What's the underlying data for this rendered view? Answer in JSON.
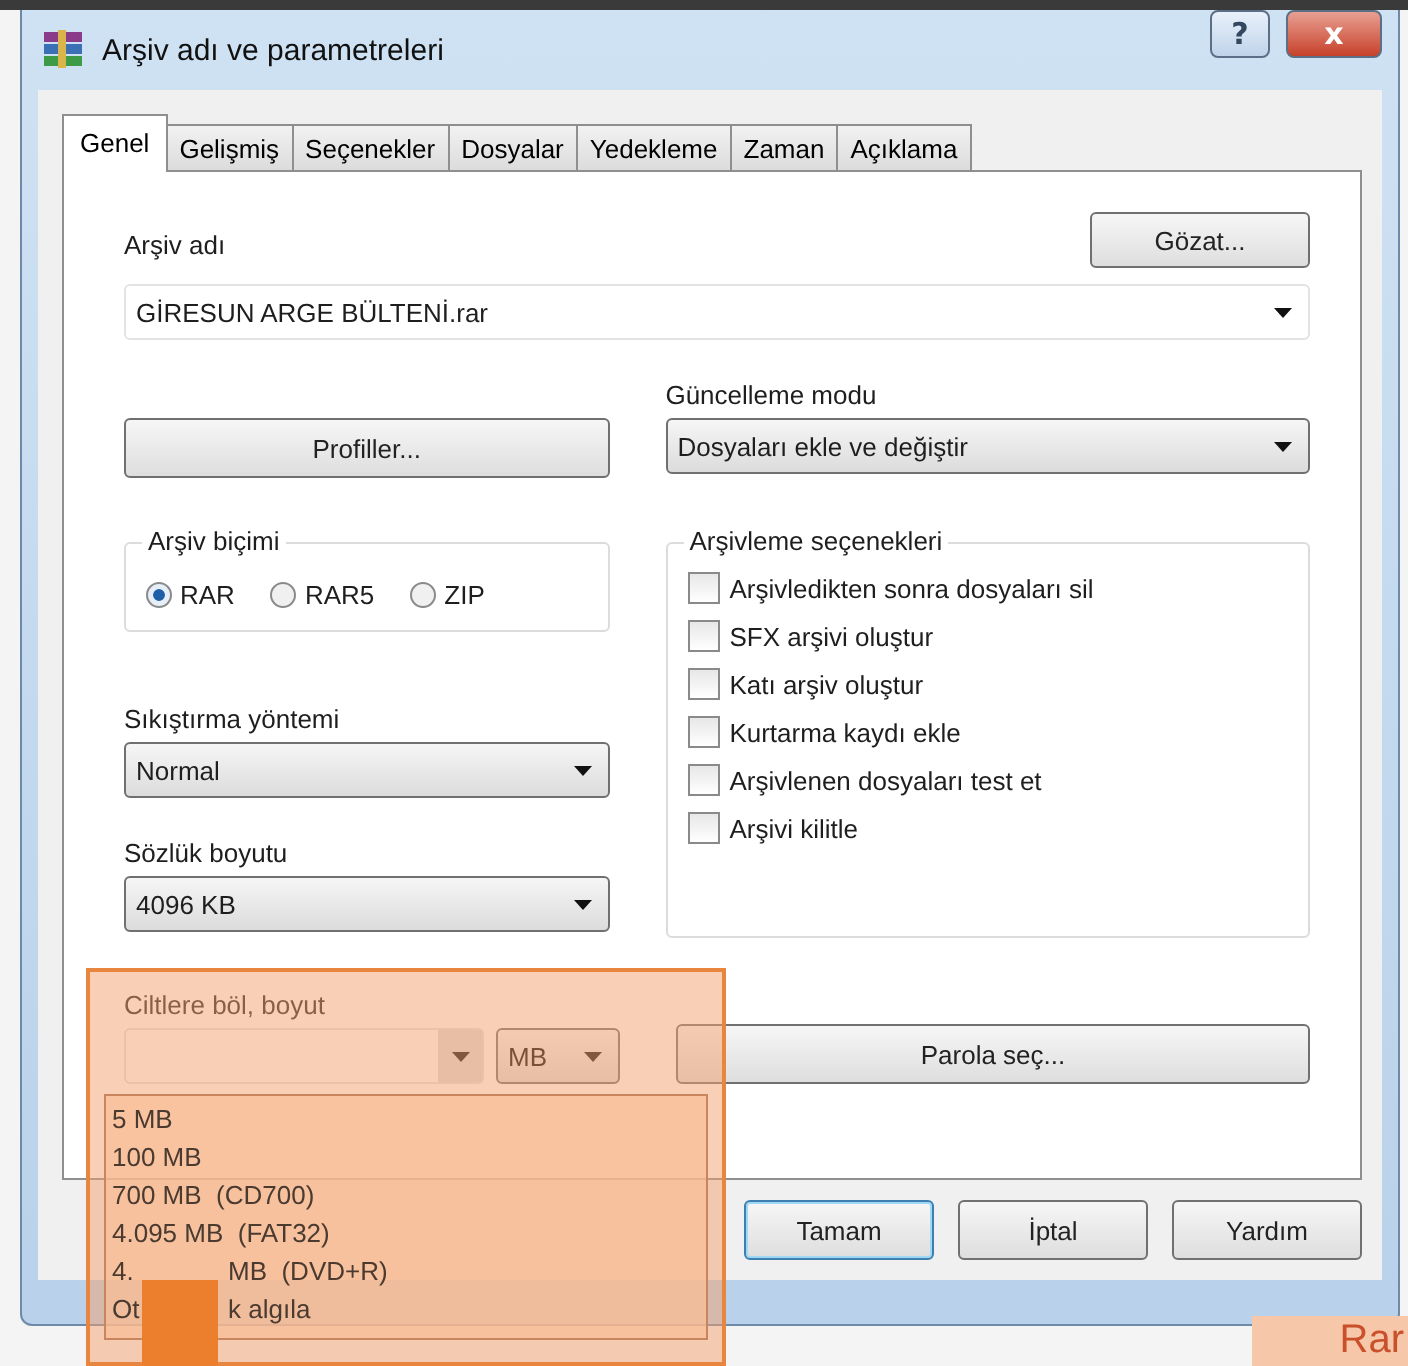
{
  "window": {
    "title": "Arşiv adı ve parametreleri",
    "title_buttons": [
      {
        "kind": "help",
        "label": "?"
      },
      {
        "kind": "close",
        "label": "x"
      }
    ]
  },
  "tabs": [
    {
      "label": "Genel",
      "selected": true
    },
    {
      "label": "Gelişmiş",
      "selected": false
    },
    {
      "label": "Seçenekler",
      "selected": false
    },
    {
      "label": "Dosyalar",
      "selected": false
    },
    {
      "label": "Yedekleme",
      "selected": false
    },
    {
      "label": "Zaman",
      "selected": false
    },
    {
      "label": "Açıklama",
      "selected": false
    }
  ],
  "archive_name": {
    "label": "Arşiv adı",
    "value": "GİRESUN ARGE BÜLTENİ.rar",
    "browse_button": "Gözat..."
  },
  "profiles_button": "Profiller...",
  "update_mode": {
    "label": "Güncelleme modu",
    "value": "Dosyaları ekle ve değiştir"
  },
  "archive_format": {
    "label": "Arşiv biçimi",
    "options": [
      {
        "label": "RAR",
        "selected": true
      },
      {
        "label": "RAR5",
        "selected": false
      },
      {
        "label": "ZIP",
        "selected": false
      }
    ]
  },
  "compression": {
    "label": "Sıkıştırma yöntemi",
    "value": "Normal"
  },
  "dictionary": {
    "label": "Sözlük boyutu",
    "value": "4096 KB"
  },
  "archive_options": {
    "label": "Arşivleme seçenekleri",
    "items": [
      {
        "label": "Arşivledikten sonra dosyaları sil",
        "checked": false
      },
      {
        "label": "SFX arşivi oluştur",
        "checked": false
      },
      {
        "label": "Katı arşiv oluştur",
        "checked": false
      },
      {
        "label": "Kurtarma kaydı ekle",
        "checked": false
      },
      {
        "label": "Arşivlenen dosyaları test et",
        "checked": false
      },
      {
        "label": "Arşivi kilitle",
        "checked": false
      }
    ]
  },
  "split": {
    "label": "Ciltlere böl, boyut",
    "unit": "MB",
    "dropdown_items": [
      {
        "parts": [
          "5 MB"
        ]
      },
      {
        "parts": [
          "100 MB"
        ]
      },
      {
        "parts": [
          "700 MB  (CD700)"
        ]
      },
      {
        "parts": [
          "4.095 MB  (FAT32)"
        ]
      },
      {
        "parts": [
          "4.",
          "MB  (DVD+R)"
        ]
      },
      {
        "parts": [
          "Ot",
          "k algıla"
        ]
      }
    ]
  },
  "password_button": "Parola seç...",
  "buttons": [
    {
      "label": "Tamam",
      "default": true
    },
    {
      "label": "İptal",
      "default": false
    },
    {
      "label": "Yardım",
      "default": false
    }
  ],
  "background": {
    "text": "Rar"
  }
}
